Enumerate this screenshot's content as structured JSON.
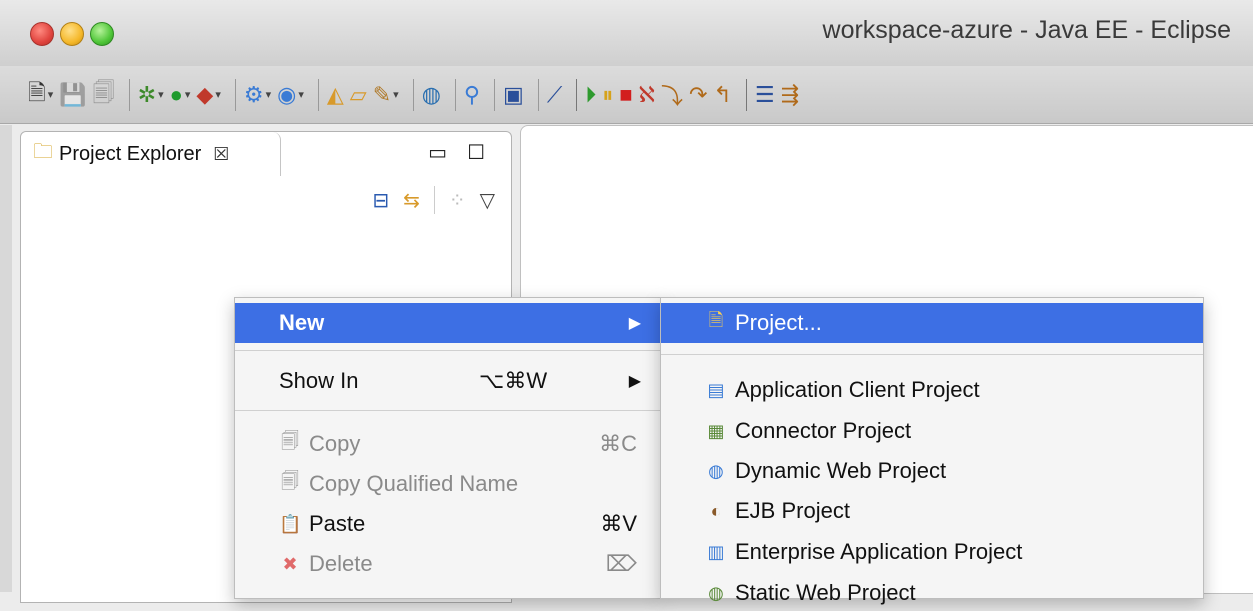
{
  "window": {
    "title": "workspace-azure - Java EE - Eclipse"
  },
  "toolbar": {
    "icons": [
      "new-wizard-icon",
      "save-icon",
      "save-all-icon",
      "debug-icon",
      "run-icon",
      "external-tools-icon",
      "new-server-icon",
      "new-ejb-icon",
      "open-type-icon",
      "open-folder-icon",
      "edit-icon",
      "globe-icon",
      "search-icon",
      "pin-icon",
      "console-icon",
      "skip-breakpoints-icon",
      "resume-icon",
      "suspend-icon",
      "terminate-icon",
      "disconnect-icon",
      "step-into-icon",
      "step-over-icon",
      "step-return-icon",
      "drop-to-frame-icon",
      "use-step-filters-icon"
    ]
  },
  "project_explorer": {
    "tab_label": "Project Explorer",
    "close_glyph": "☒",
    "minimize_glyph": "▭",
    "maximize_glyph": "☐",
    "tools": [
      "collapse-all-icon",
      "link-editor-icon",
      "filters-icon",
      "view-menu-icon"
    ]
  },
  "context_menu": {
    "items": [
      {
        "label": "New",
        "shortcut": "",
        "arrow": "▶",
        "state": "active"
      },
      {
        "label": "Show In",
        "shortcut": "⌥⌘W",
        "arrow": "▶",
        "state": "enabled"
      },
      {
        "label": "Copy",
        "shortcut": "⌘C",
        "arrow": "",
        "state": "disabled"
      },
      {
        "label": "Copy Qualified Name",
        "shortcut": "",
        "arrow": "",
        "state": "disabled"
      },
      {
        "label": "Paste",
        "shortcut": "⌘V",
        "arrow": "",
        "state": "enabled"
      },
      {
        "label": "Delete",
        "shortcut": "⌦",
        "arrow": "",
        "state": "disabled"
      }
    ]
  },
  "new_submenu": {
    "items": [
      {
        "label": "Project...",
        "state": "active"
      },
      {
        "label": "Application Client Project",
        "state": "enabled"
      },
      {
        "label": "Connector Project",
        "state": "enabled"
      },
      {
        "label": "Dynamic Web Project",
        "state": "enabled"
      },
      {
        "label": "EJB Project",
        "state": "enabled"
      },
      {
        "label": "Enterprise Application Project",
        "state": "enabled"
      },
      {
        "label": "Static Web Project",
        "state": "enabled"
      }
    ]
  },
  "colors": {
    "selection": "#3d6fe4",
    "menu_bg": "#f5f5f5",
    "disabled_text": "#8a8a8a"
  }
}
